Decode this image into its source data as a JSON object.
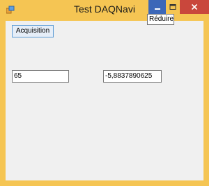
{
  "window": {
    "title": "Test DAQNavi",
    "colors": {
      "frame": "#f5c553",
      "client": "#f0f0f0",
      "minimize": "#3c67b8",
      "close": "#c9473c"
    }
  },
  "titlebar": {
    "icons": {
      "app": "app-window-icon",
      "minimize": "minimize-icon",
      "maximize": "maximize-icon",
      "close": "close-icon"
    },
    "tooltip": "Réduire"
  },
  "form": {
    "acquisition_label": "Acquisition",
    "field1_value": "65",
    "field2_value": "-5,8837890625"
  }
}
